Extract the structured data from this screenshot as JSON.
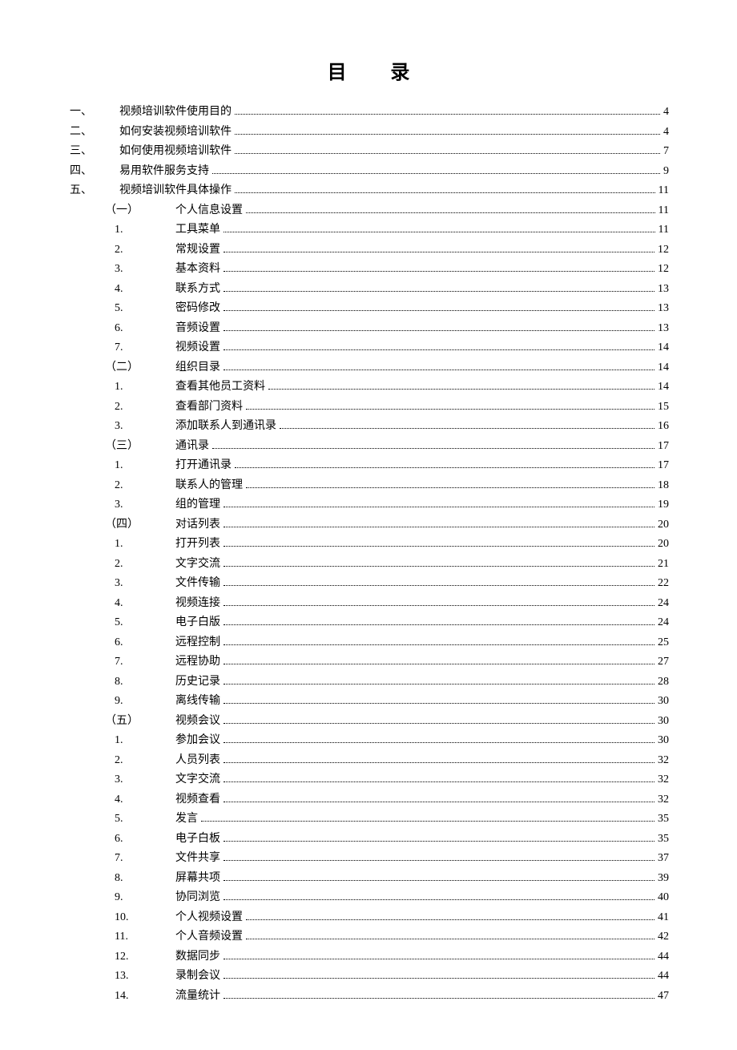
{
  "title": "目 录",
  "entries": [
    {
      "level": 1,
      "marker": "一、",
      "label": "视频培训软件使用目的",
      "page": "4"
    },
    {
      "level": 1,
      "marker": "二、",
      "label": "如何安装视频培训软件",
      "page": "4"
    },
    {
      "level": 1,
      "marker": "三、",
      "label": "如何使用视频培训软件",
      "page": "7"
    },
    {
      "level": 1,
      "marker": "四、",
      "label": "易用软件服务支持",
      "page": "9"
    },
    {
      "level": 1,
      "marker": "五、",
      "label": "视频培训软件具体操作",
      "page": "11"
    },
    {
      "level": 2,
      "marker": "（一）",
      "label": "个人信息设置",
      "page": "11"
    },
    {
      "level": 3,
      "marker": "1.",
      "label": "工具菜单",
      "page": "11"
    },
    {
      "level": 3,
      "marker": "2.",
      "label": "常规设置",
      "page": "12"
    },
    {
      "level": 3,
      "marker": "3.",
      "label": "基本资料",
      "page": "12"
    },
    {
      "level": 3,
      "marker": "4.",
      "label": "联系方式",
      "page": "13"
    },
    {
      "level": 3,
      "marker": "5.",
      "label": "密码修改",
      "page": "13"
    },
    {
      "level": 3,
      "marker": "6.",
      "label": "音频设置",
      "page": "13"
    },
    {
      "level": 3,
      "marker": "7.",
      "label": "视频设置",
      "page": "14"
    },
    {
      "level": 2,
      "marker": "（二）",
      "label": "组织目录",
      "page": "14"
    },
    {
      "level": 3,
      "marker": "1.",
      "label": "查看其他员工资料",
      "page": "14"
    },
    {
      "level": 3,
      "marker": "2.",
      "label": "查看部门资料",
      "page": "15"
    },
    {
      "level": 3,
      "marker": "3.",
      "label": "添加联系人到通讯录",
      "page": "16"
    },
    {
      "level": 2,
      "marker": "（三）",
      "label": "通讯录",
      "page": "17"
    },
    {
      "level": 3,
      "marker": "1.",
      "label": "打开通讯录",
      "page": "17"
    },
    {
      "level": 3,
      "marker": "2.",
      "label": "联系人的管理",
      "page": "18"
    },
    {
      "level": 3,
      "marker": "3.",
      "label": "组的管理",
      "page": "19"
    },
    {
      "level": 2,
      "marker": "（四）",
      "label": "对话列表",
      "page": "20"
    },
    {
      "level": 3,
      "marker": "1.",
      "label": "打开列表",
      "page": "20"
    },
    {
      "level": 3,
      "marker": "2.",
      "label": "文字交流",
      "page": "21"
    },
    {
      "level": 3,
      "marker": "3.",
      "label": "文件传输",
      "page": "22"
    },
    {
      "level": 3,
      "marker": "4.",
      "label": "视频连接",
      "page": "24"
    },
    {
      "level": 3,
      "marker": "5.",
      "label": "电子白版",
      "page": "24"
    },
    {
      "level": 3,
      "marker": "6.",
      "label": "远程控制",
      "page": "25"
    },
    {
      "level": 3,
      "marker": "7.",
      "label": "远程协助",
      "page": "27"
    },
    {
      "level": 3,
      "marker": "8.",
      "label": "历史记录",
      "page": "28"
    },
    {
      "level": 3,
      "marker": "9.",
      "label": "离线传输",
      "page": "30"
    },
    {
      "level": 2,
      "marker": "（五）",
      "label": "视频会议",
      "page": "30"
    },
    {
      "level": 3,
      "marker": "1.",
      "label": "参加会议",
      "page": "30"
    },
    {
      "level": 3,
      "marker": "2.",
      "label": "人员列表",
      "page": "32"
    },
    {
      "level": 3,
      "marker": "3.",
      "label": "文字交流",
      "page": "32"
    },
    {
      "level": 3,
      "marker": "4.",
      "label": "视频查看",
      "page": "32"
    },
    {
      "level": 3,
      "marker": "5.",
      "label": "发言",
      "page": "35"
    },
    {
      "level": 3,
      "marker": "6.",
      "label": "电子白板",
      "page": "35"
    },
    {
      "level": 3,
      "marker": "7.",
      "label": "文件共享",
      "page": "37"
    },
    {
      "level": 3,
      "marker": "8.",
      "label": "屏幕共项",
      "page": "39"
    },
    {
      "level": 3,
      "marker": "9.",
      "label": "协同浏览",
      "page": "40"
    },
    {
      "level": 3,
      "marker": "10.",
      "label": "个人视频设置",
      "page": "41"
    },
    {
      "level": 3,
      "marker": "11.",
      "label": "个人音频设置",
      "page": "42"
    },
    {
      "level": 3,
      "marker": "12.",
      "label": "数据同步",
      "page": "44"
    },
    {
      "level": 3,
      "marker": "13.",
      "label": "录制会议",
      "page": "44"
    },
    {
      "level": 3,
      "marker": "14.",
      "label": "流量统计",
      "page": "47"
    }
  ]
}
